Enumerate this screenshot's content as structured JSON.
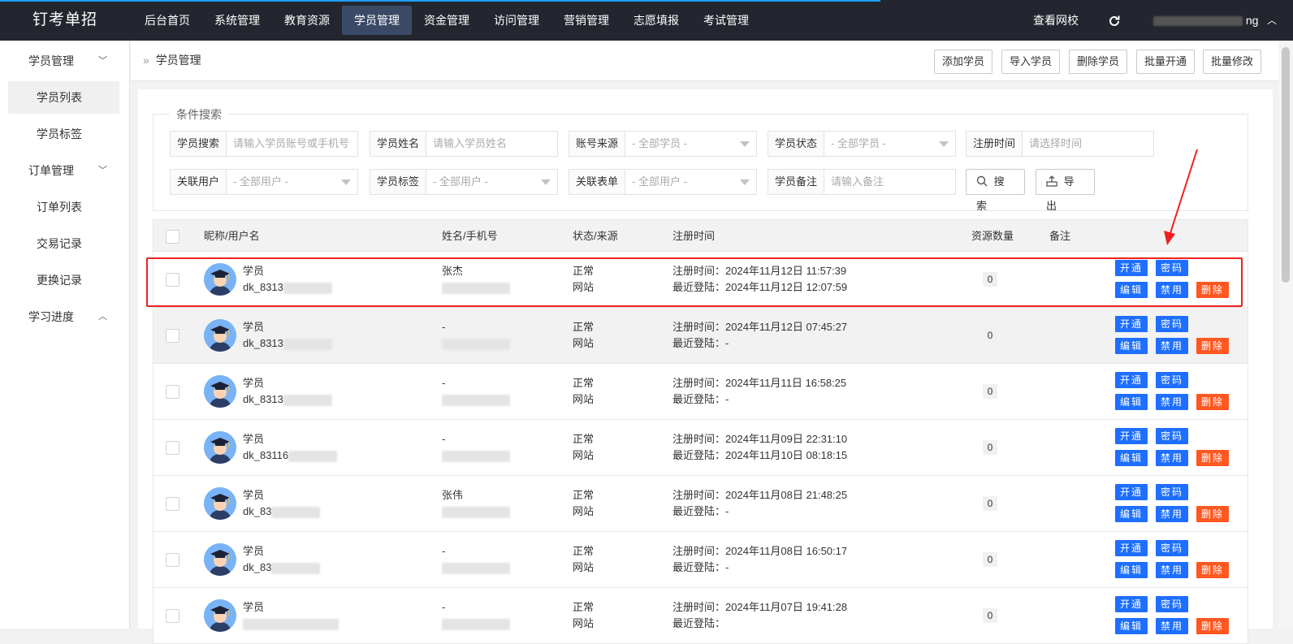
{
  "app": {
    "logo": "钉考单招"
  },
  "topnav": {
    "items": [
      {
        "label": "后台首页"
      },
      {
        "label": "系统管理"
      },
      {
        "label": "教育资源"
      },
      {
        "label": "学员管理",
        "active": true
      },
      {
        "label": "资金管理"
      },
      {
        "label": "访问管理"
      },
      {
        "label": "营销管理"
      },
      {
        "label": "志愿填报"
      },
      {
        "label": "考试管理"
      }
    ],
    "view_site": "查看网校",
    "refresh_icon": "refresh-icon",
    "user_suffix": "ng"
  },
  "sidebar": {
    "groups": [
      {
        "label": "学员管理",
        "expanded": true,
        "items": [
          {
            "label": "学员列表",
            "active": true
          },
          {
            "label": "学员标签"
          }
        ]
      },
      {
        "label": "订单管理",
        "expanded": true,
        "items": [
          {
            "label": "订单列表"
          },
          {
            "label": "交易记录"
          },
          {
            "label": "更换记录"
          }
        ]
      },
      {
        "label": "学习进度",
        "expanded": false,
        "items": []
      }
    ]
  },
  "breadcrumb": {
    "sep": "»",
    "current": "学员管理"
  },
  "header_buttons": {
    "add": "添加学员",
    "import": "导入学员",
    "delete": "删除学员",
    "batch_open": "批量开通",
    "batch_edit": "批量修改"
  },
  "search": {
    "legend": "条件搜索",
    "fields": {
      "keyword": {
        "label": "学员搜索",
        "placeholder": "请输入学员账号或手机号"
      },
      "name": {
        "label": "学员姓名",
        "placeholder": "请输入学员姓名"
      },
      "source": {
        "label": "账号来源",
        "value": "- 全部学员 -"
      },
      "status": {
        "label": "学员状态",
        "value": "- 全部学员 -"
      },
      "regtime": {
        "label": "注册时间",
        "placeholder": "请选择时间"
      },
      "user": {
        "label": "关联用户",
        "value": "- 全部用户 -"
      },
      "tag": {
        "label": "学员标签",
        "value": "- 全部用户 -"
      },
      "form": {
        "label": "关联表单",
        "value": "- 全部用户 -"
      },
      "remark": {
        "label": "学员备注",
        "placeholder": "请输入备注"
      }
    },
    "search_btn": "搜 索",
    "export_btn": "导 出"
  },
  "table": {
    "headers": {
      "nick": "昵称/用户名",
      "name_phone": "姓名/手机号",
      "status_src": "状态/来源",
      "regtime": "注册时间",
      "resources": "资源数量",
      "remark": "备注"
    },
    "reg_prefix": "注册时间：",
    "login_prefix": "最近登陆：",
    "actions": {
      "open": "开通",
      "password": "密码",
      "edit": "编辑",
      "disable": "禁用",
      "delete": "删除"
    },
    "rows": [
      {
        "nick": "学员",
        "user": "dk_8313",
        "name": "张杰",
        "phone": "",
        "status": "正常",
        "source": "网站",
        "reg": "2024年11月12日 11:57:39",
        "login": "2024年11月12日 12:07:59",
        "res": "0"
      },
      {
        "nick": "学员",
        "user": "dk_8313",
        "name": "-",
        "phone": "",
        "status": "正常",
        "source": "网站",
        "reg": "2024年11月12日 07:45:27",
        "login": "-",
        "res": "0"
      },
      {
        "nick": "学员",
        "user": "dk_8313",
        "name": "-",
        "phone": "",
        "status": "正常",
        "source": "网站",
        "reg": "2024年11月11日 16:58:25",
        "login": "-",
        "res": "0"
      },
      {
        "nick": "学员",
        "user": "dk_83116",
        "name": "-",
        "phone": "",
        "status": "正常",
        "source": "网站",
        "reg": "2024年11月09日 22:31:10",
        "login": "2024年11月10日 08:18:15",
        "res": "0"
      },
      {
        "nick": "学员",
        "user": "dk_83",
        "name": "张伟",
        "phone": "",
        "status": "正常",
        "source": "网站",
        "reg": "2024年11月08日 21:48:25",
        "login": "-",
        "res": "0"
      },
      {
        "nick": "学员",
        "user": "dk_83",
        "name": "-",
        "phone": "",
        "status": "正常",
        "source": "网站",
        "reg": "2024年11月08日 16:50:17",
        "login": "-",
        "res": "0"
      },
      {
        "nick": "学员",
        "user": "",
        "name": "-",
        "phone": "",
        "status": "正常",
        "source": "网站",
        "reg": "2024年11月07日 19:41:28",
        "login": "",
        "res": "0"
      }
    ]
  },
  "colors": {
    "topbar": "#23262e",
    "primary": "#1e6fff",
    "danger": "#ff5722",
    "ok": "#1a9e35",
    "highlight": "#f02020"
  }
}
